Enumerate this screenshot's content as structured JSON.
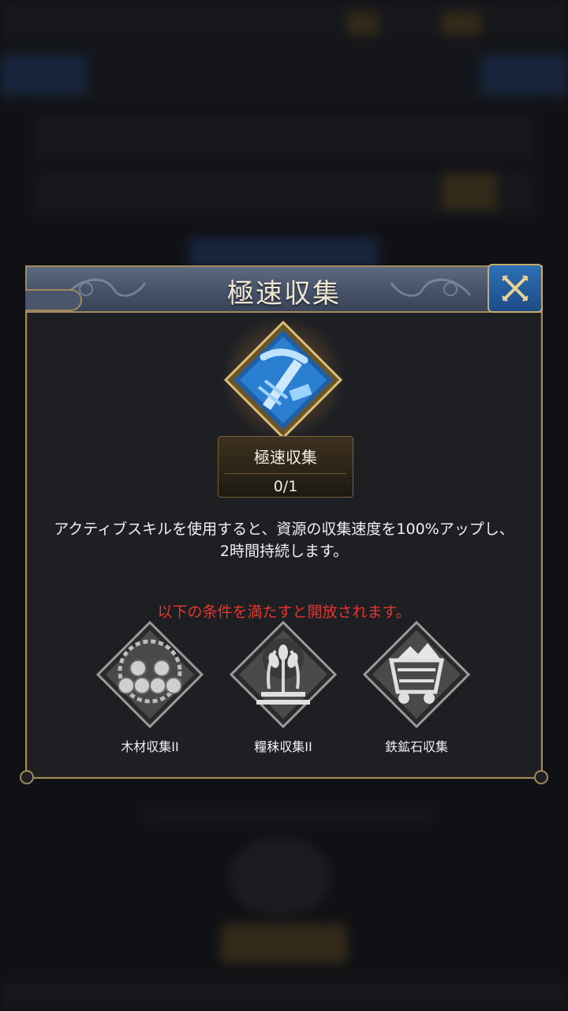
{
  "dialog": {
    "title": "極速収集",
    "close_icon": "close-x-icon"
  },
  "skill": {
    "icon": "pickaxe-icon",
    "name": "極速収集",
    "level": "0/1",
    "description_line1": "アクティブスキルを使用すると、資源の収集速度を100%アップし、",
    "description_line2": "2時間持続します。"
  },
  "requirements": {
    "heading": "以下の条件を満たすと開放されます。",
    "items": [
      {
        "icon": "logs-icon",
        "label": "木材収集II"
      },
      {
        "icon": "wheat-icon",
        "label": "糧秣収集II"
      },
      {
        "icon": "ore-cart-icon",
        "label": "鉄鉱石収集"
      }
    ]
  },
  "colors": {
    "frame_gold": "#a08a5c",
    "header_blue": "#46526a",
    "close_blue": "#2d6fb5",
    "skill_blue": "#2b7fd0",
    "requirement_red": "#e5352e"
  }
}
